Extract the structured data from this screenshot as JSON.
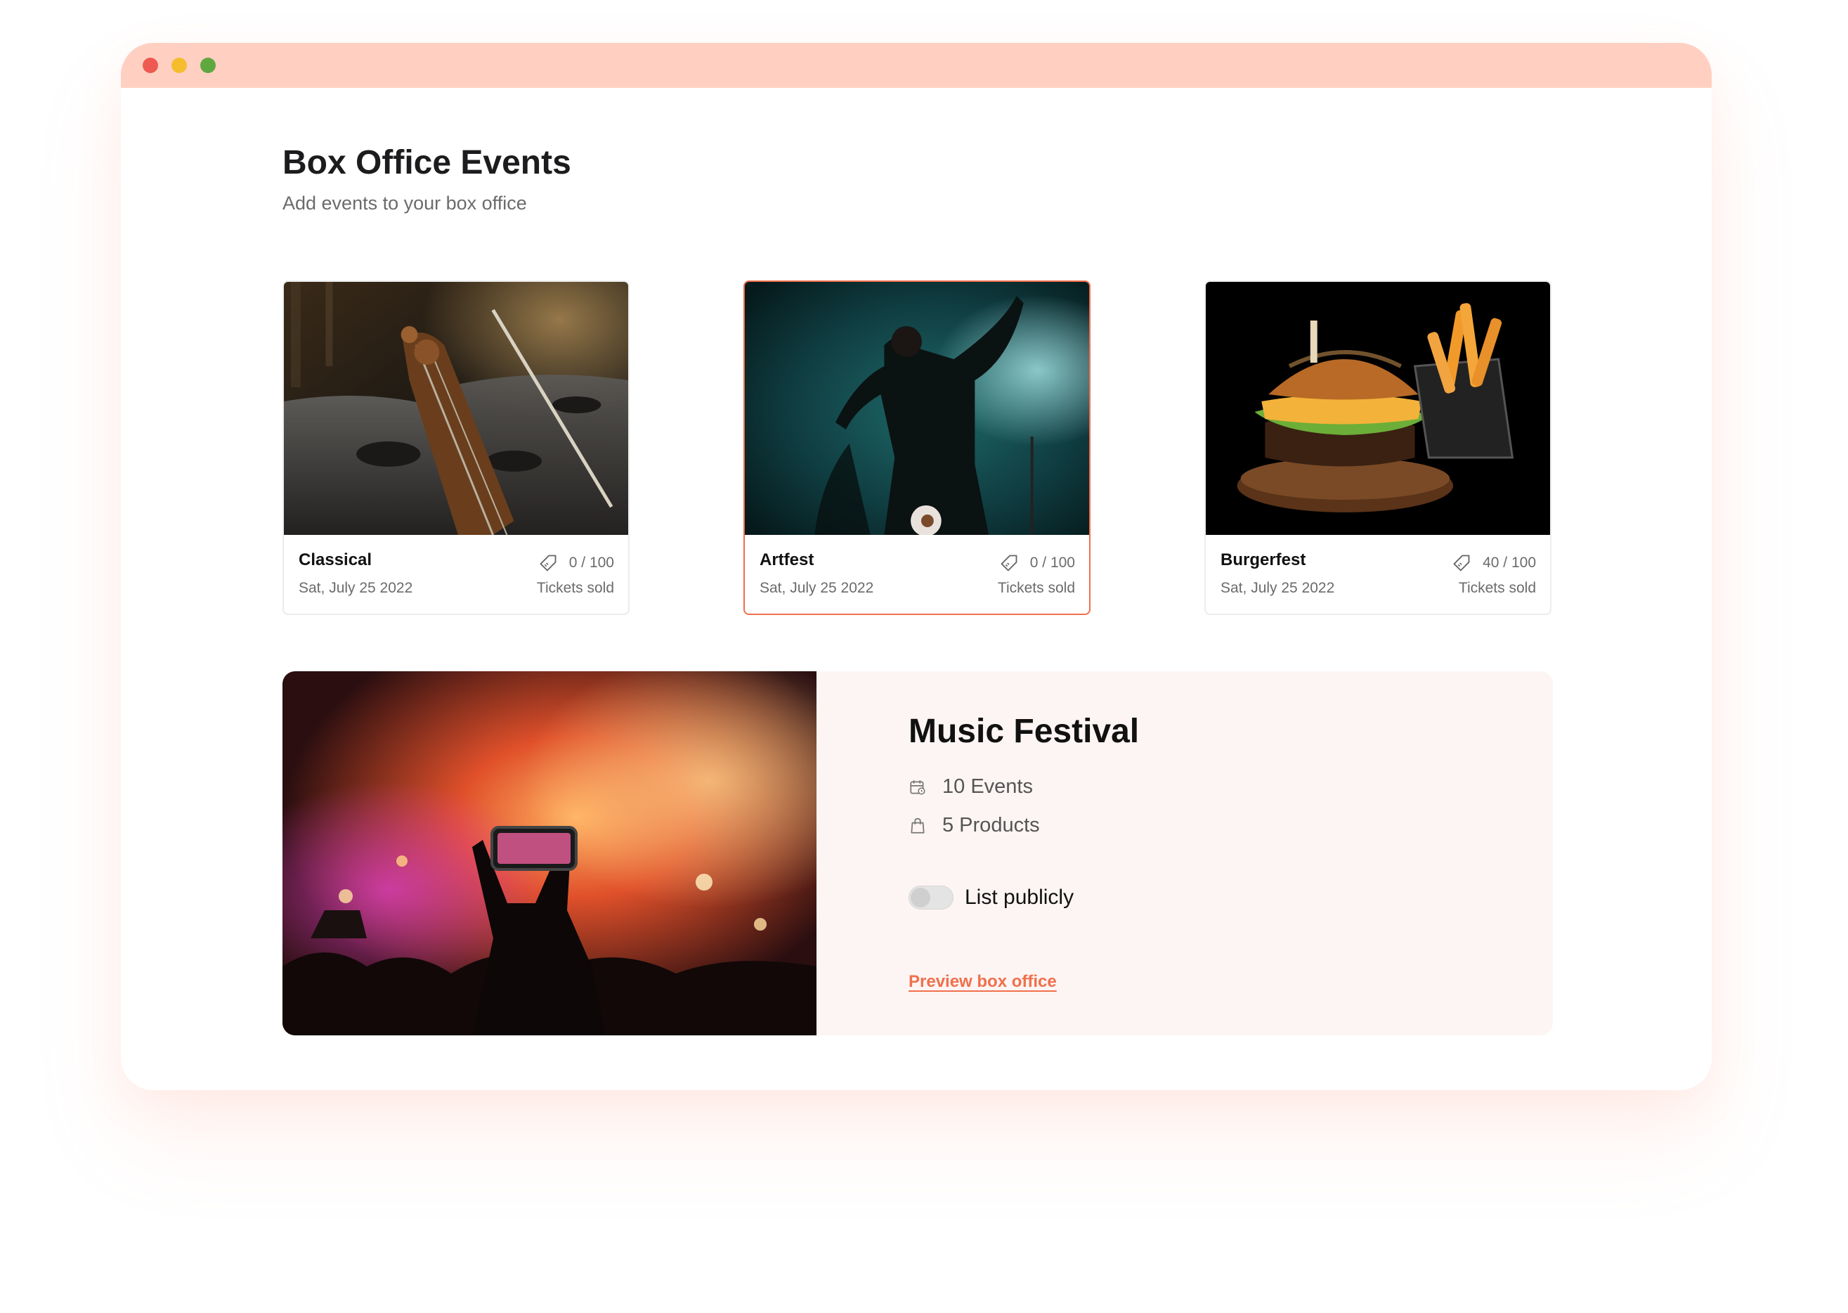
{
  "theme": {
    "accent": "#f0704d",
    "titlebar": "#ffd0c2",
    "featured_background": "#fdf5f3"
  },
  "window": {
    "controls": [
      {
        "name": "close",
        "color": "#ee5a52"
      },
      {
        "name": "minimize",
        "color": "#f5bd2e"
      },
      {
        "name": "maximize",
        "color": "#5fa83f"
      }
    ]
  },
  "header": {
    "title": "Box Office Events",
    "subtitle": "Add events to your box office"
  },
  "events": [
    {
      "name": "Classical",
      "date": "Sat, July 25 2022",
      "tickets": "0 / 100",
      "tickets_label": "Tickets sold",
      "image": "violin-photo",
      "selected": false
    },
    {
      "name": "Artfest",
      "date": "Sat, July 25 2022",
      "tickets": "0 / 100",
      "tickets_label": "Tickets sold",
      "image": "singer-photo",
      "selected": true
    },
    {
      "name": "Burgerfest",
      "date": "Sat, July 25 2022",
      "tickets": "40 / 100",
      "tickets_label": "Tickets sold",
      "image": "burger-photo",
      "selected": false
    }
  ],
  "featured": {
    "title": "Music Festival",
    "events_count": "10 Events",
    "products_count": "5 Products",
    "list_publicly_label": "List publicly",
    "list_publicly": false,
    "preview_link": "Preview box office",
    "image": "concert-crowd-photo",
    "icons": {
      "events": "calendar-icon",
      "products": "shopping-bag-icon",
      "tickets": "ticket-tag-icon"
    }
  }
}
